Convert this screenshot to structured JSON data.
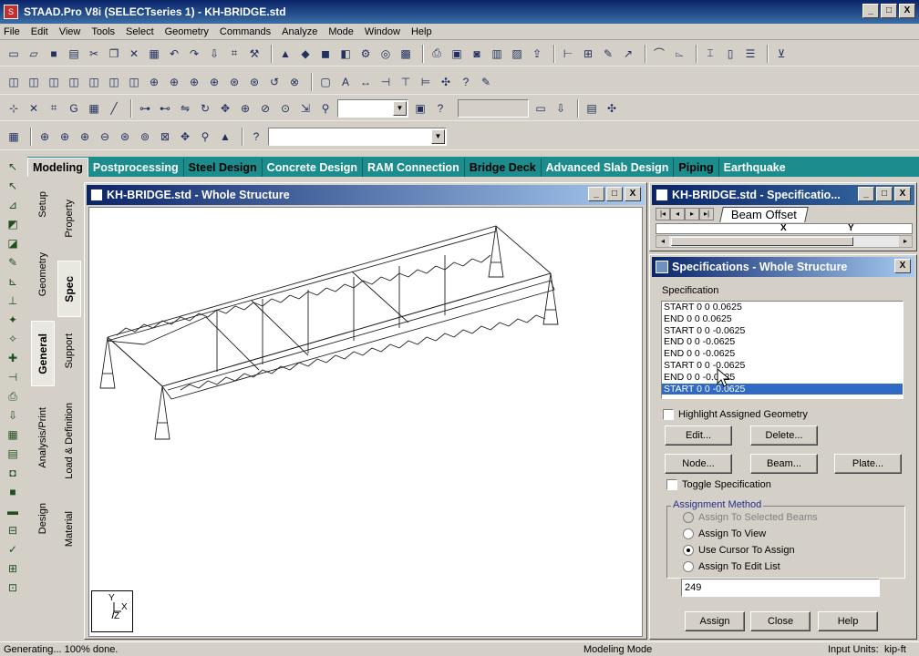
{
  "app": {
    "title": "STAAD.Pro V8i (SELECTseries 1) - KH-BRIDGE.std",
    "min_label": "_",
    "max_label": "□",
    "close_label": "X"
  },
  "menu": [
    "File",
    "Edit",
    "View",
    "Tools",
    "Select",
    "Geometry",
    "Commands",
    "Analyze",
    "Mode",
    "Window",
    "Help"
  ],
  "tabs": [
    {
      "label": "Modeling",
      "active": true
    },
    {
      "label": "Postprocessing"
    },
    {
      "label": "Steel Design"
    },
    {
      "label": "Concrete Design"
    },
    {
      "label": "RAM Connection"
    },
    {
      "label": "Bridge Deck"
    },
    {
      "label": "Advanced Slab Design"
    },
    {
      "label": "Piping"
    },
    {
      "label": "Earthquake"
    }
  ],
  "left_vtabs": [
    "Setup",
    "Geometry",
    "General",
    "Analysis/Print",
    "Design"
  ],
  "right_vtabs": [
    "Property",
    "Spec",
    "Support",
    "Load & Definition",
    "Material"
  ],
  "viewport": {
    "title": "KH-BRIDGE.std - Whole Structure",
    "axis_y": "Y",
    "axis_x": "X",
    "axis_z": "Z"
  },
  "spec_table": {
    "title": "KH-BRIDGE.std - Specificatio...",
    "sheet_tab": "Beam Offset",
    "col_x": "X",
    "col_y": "Y"
  },
  "spec_panel": {
    "title": "Specifications - Whole Structure",
    "list_label": "Specification",
    "items": [
      "START 0 0 0.0625",
      "END 0 0 0.0625",
      "START 0 0 -0.0625",
      "END 0 0 -0.0625",
      "END 0 0 -0.0625",
      "START 0 0 -0.0625",
      "END 0 0 -0.0625",
      "START 0 0 -0.0625"
    ],
    "selected_index": 7,
    "highlight_label": "Highlight Assigned Geometry",
    "edit_btn": "Edit...",
    "delete_btn": "Delete...",
    "node_btn": "Node...",
    "beam_btn": "Beam...",
    "plate_btn": "Plate...",
    "toggle_label": "Toggle Specification",
    "assign_group": "Assignment Method",
    "opt_selected": "Assign To Selected Beams",
    "opt_view": "Assign To View",
    "opt_cursor": "Use Cursor To Assign",
    "opt_edit": "Assign To Edit List",
    "edit_list_value": "249",
    "assign_btn": "Assign",
    "close_btn": "Close",
    "help_btn": "Help"
  },
  "status": {
    "left": "Generating... 100% done.",
    "mode": "Modeling Mode",
    "units_label": "Input Units:",
    "units": "kip-ft"
  }
}
